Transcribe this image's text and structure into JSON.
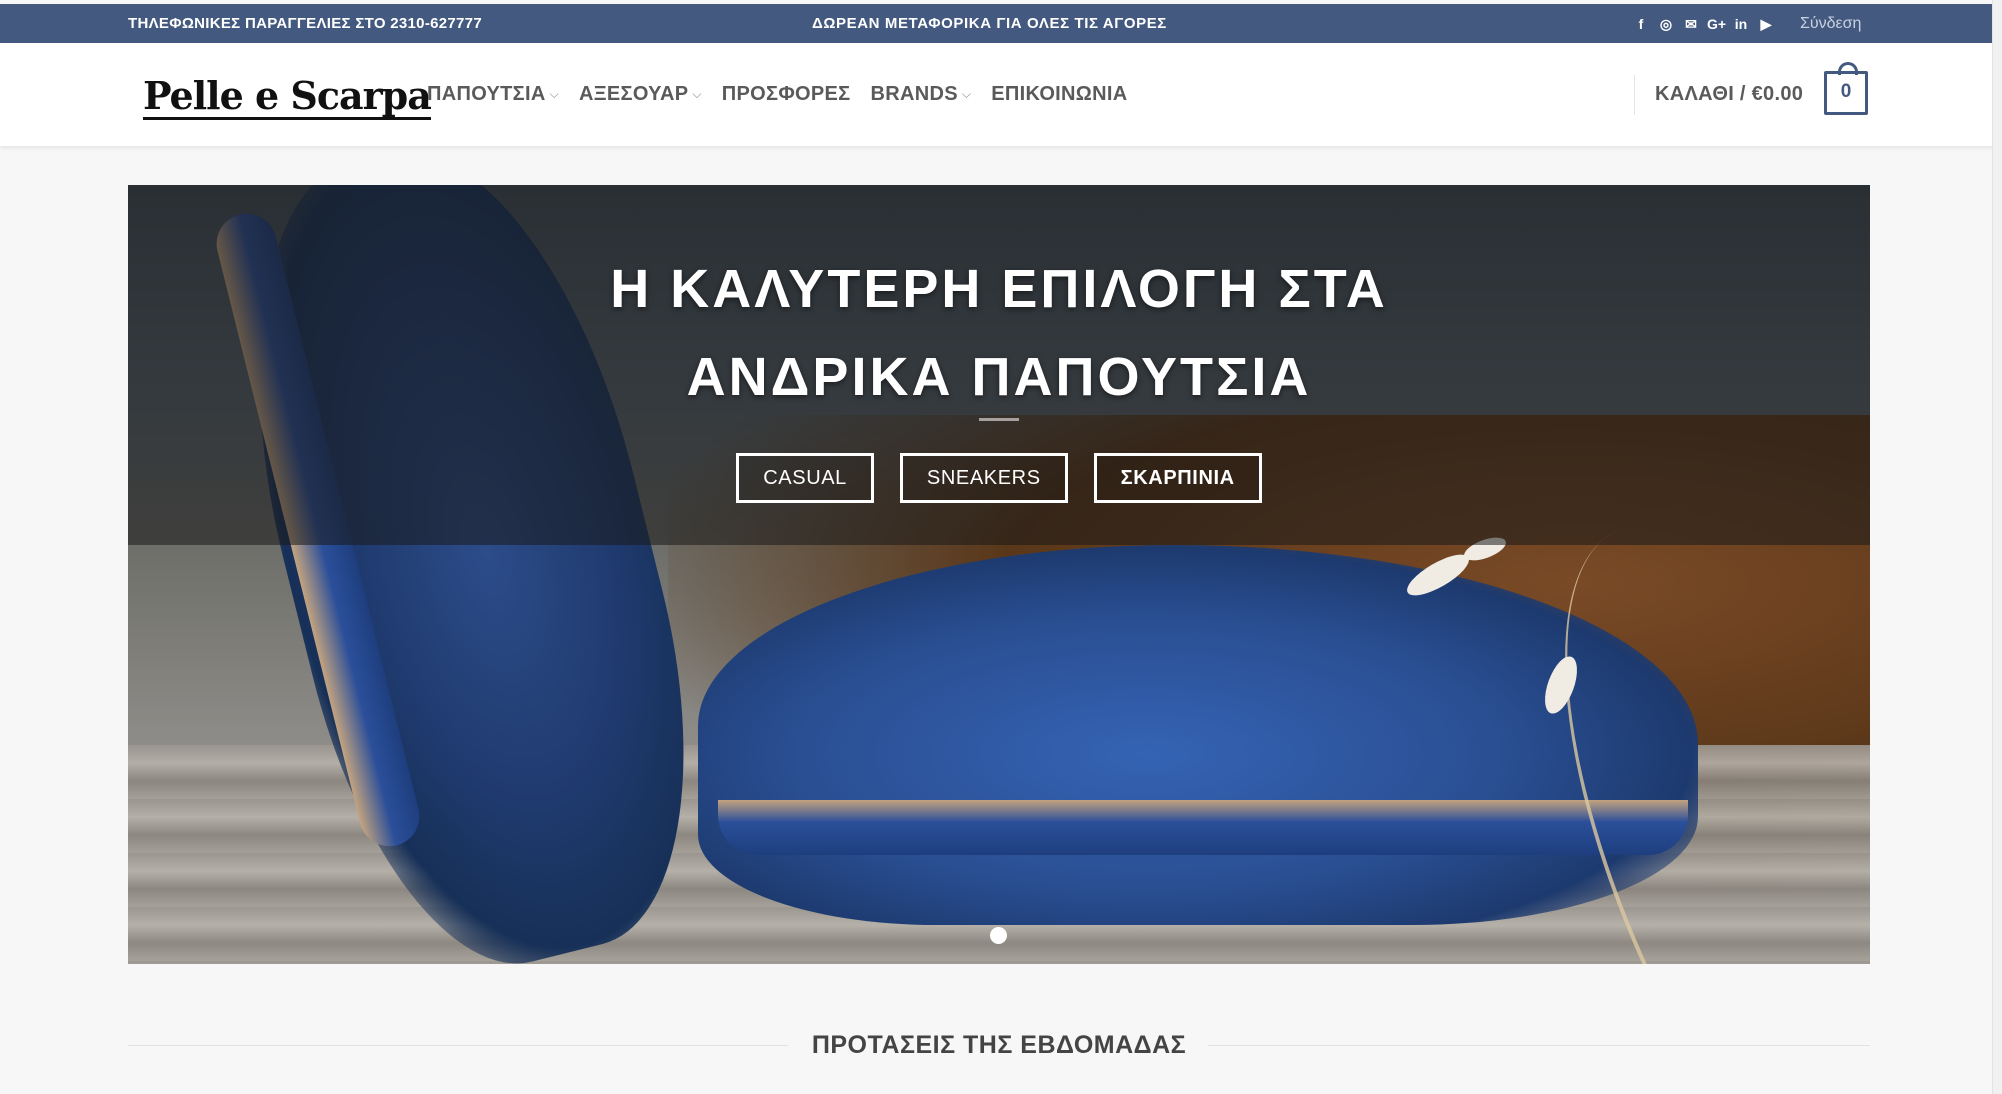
{
  "topbar": {
    "phone": "ΤΗΛΕΦΩΝΙΚΕΣ ΠΑΡΑΓΓΕΛΙΕΣ ΣΤΟ 2310-627777",
    "shipping": "ΔΩΡΕΑΝ ΜΕΤΑΦΟΡΙΚΑ ΓΙΑ ΟΛΕΣ ΤΙΣ ΑΓΟΡΕΣ",
    "social_icons": [
      "facebook-icon",
      "instagram-icon",
      "email-icon",
      "google-plus-icon",
      "linkedin-icon",
      "youtube-icon"
    ],
    "social_glyphs": [
      "f",
      "◎",
      "✉",
      "G+",
      "in",
      "▶"
    ],
    "login": "Σύνδεση",
    "bg_color": "#44597f"
  },
  "header": {
    "logo": "Pelle e Scarpa",
    "nav": [
      {
        "label": "ΠΑΠΟΥΤΣΙΑ",
        "has_dropdown": true
      },
      {
        "label": "ΑΞΕΣΟΥΑΡ",
        "has_dropdown": true
      },
      {
        "label": "ΠΡΟΣΦΟΡΕΣ",
        "has_dropdown": false
      },
      {
        "label": "BRANDS",
        "has_dropdown": true
      },
      {
        "label": "ΕΠΙΚΟΙΝΩΝΙΑ",
        "has_dropdown": false
      }
    ],
    "cart_label": "ΚΑΛΑΘΙ / €0.00",
    "cart_count": "0"
  },
  "hero": {
    "title_line1": "Η ΚΑΛΥΤΕΡΗ ΕΠΙΛΟΓΗ ΣΤΑ",
    "title_line2": "ΑΝΔΡΙΚΑ ΠΑΠΟΥΤΣΙΑ",
    "buttons": [
      "CASUAL",
      "SNEAKERS",
      "ΣΚΑΡΠΙΝΙΑ"
    ]
  },
  "section": {
    "title": "ΠΡΟΤΑΣΕΙΣ ΤΗΣ ΕΒΔΟΜΑΔΑΣ"
  }
}
